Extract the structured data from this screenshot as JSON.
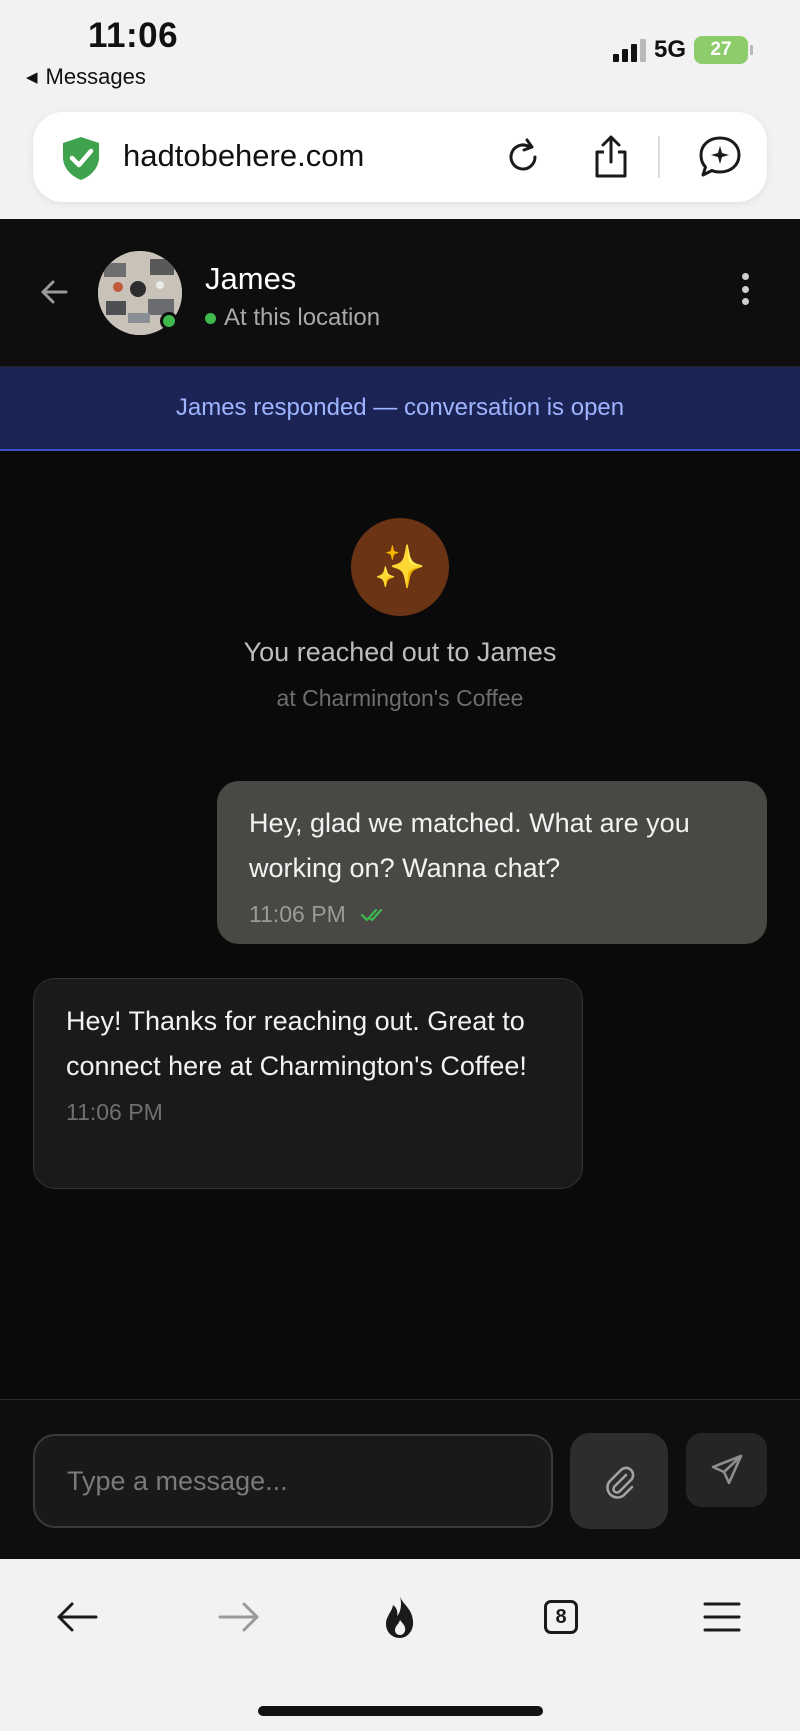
{
  "status_bar": {
    "time": "11:06",
    "back_app": "Messages",
    "network": "5G",
    "battery": "27"
  },
  "browser": {
    "url": "hadtobehere.com",
    "tab_count": "8",
    "icons": [
      "shield-check-icon",
      "reload-icon",
      "share-icon",
      "ai-chat-icon",
      "back-arrow-icon",
      "forward-arrow-icon",
      "fire-icon",
      "tabs-icon",
      "menu-icon"
    ]
  },
  "chat": {
    "contact_name": "James",
    "presence": "At this location",
    "banner": "James responded — conversation is open",
    "intro_icon": "✨",
    "intro_title": "You reached out to James",
    "intro_subtitle": "at Charmington's Coffee",
    "messages": [
      {
        "direction": "outgoing",
        "text": "Hey, glad we matched. What are you working on? Wanna chat?",
        "time": "11:06 PM",
        "read": true
      },
      {
        "direction": "incoming",
        "text": "Hey! Thanks for reaching out. Great to connect here at Charmington's Coffee!",
        "time": "11:06 PM"
      }
    ],
    "composer": {
      "placeholder": "Type a message...",
      "value": ""
    }
  },
  "colors": {
    "online": "#3fb950",
    "banner_bg": "#1b2455",
    "banner_text": "#9fb4ff",
    "read_check": "#3fb950"
  }
}
